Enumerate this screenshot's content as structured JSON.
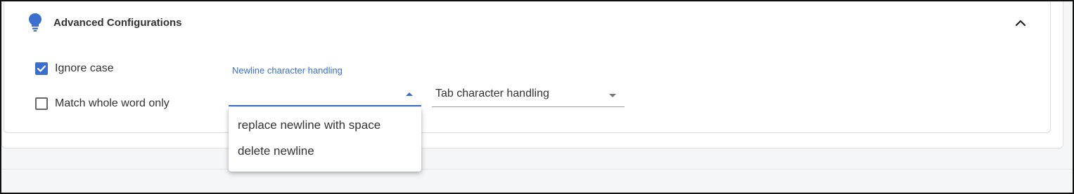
{
  "panel": {
    "title": "Advanced Configurations"
  },
  "options": {
    "ignore_case": {
      "label": "Ignore case",
      "checked": true
    },
    "match_whole_word": {
      "label": "Match whole word only",
      "checked": false
    }
  },
  "newline_select": {
    "label": "Newline character handling",
    "value": "",
    "state": "open",
    "options": [
      "replace newline with space",
      "delete newline"
    ]
  },
  "tab_select": {
    "placeholder": "Tab character handling",
    "value": ""
  },
  "icons": {
    "panel_icon": "lightbulb-icon",
    "collapse": "chevron-up-icon",
    "check": "check-icon",
    "newline_arrow": "arrow-up-icon",
    "tab_arrow": "arrow-down-icon"
  },
  "colors": {
    "accent": "#3a6fcf",
    "text": "#333333",
    "page_background": "#f5f6f8"
  }
}
